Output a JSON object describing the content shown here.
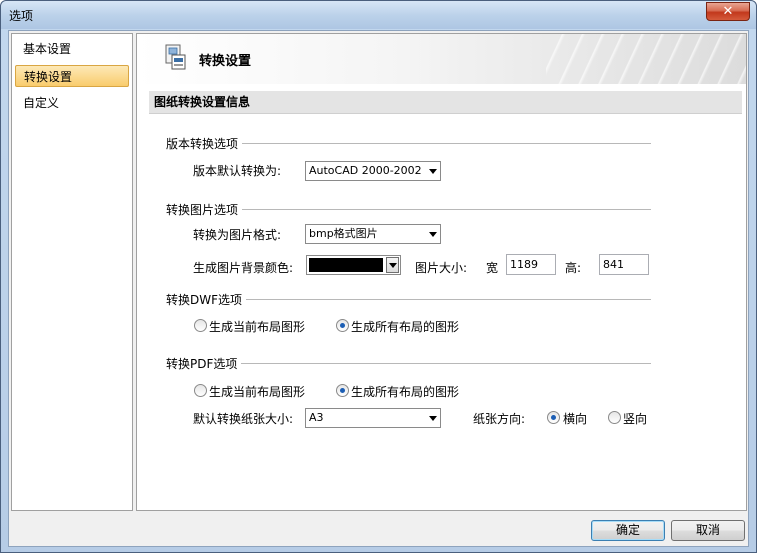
{
  "window": {
    "title": "选项",
    "close_glyph": "✕"
  },
  "sidebar": {
    "items": [
      {
        "label": "基本设置",
        "selected": false
      },
      {
        "label": "转换设置",
        "selected": true
      },
      {
        "label": "自定义",
        "selected": false
      }
    ]
  },
  "banner": {
    "title": "转换设置",
    "icon": "convert-settings-icon"
  },
  "section": {
    "title": "图纸转换设置信息"
  },
  "version_group": {
    "title": "版本转换选项",
    "default_label": "版本默认转换为:",
    "default_value": "AutoCAD 2000-2002"
  },
  "image_group": {
    "title": "转换图片选项",
    "format_label": "转换为图片格式:",
    "format_value": "bmp格式图片",
    "bg_label": "生成图片背景颜色:",
    "bg_color": "#000000",
    "size_label": "图片大小:",
    "width_label": "宽",
    "width_value": "1189",
    "height_label": "高:",
    "height_value": "841"
  },
  "dwf_group": {
    "title": "转换DWF选项",
    "option_current": "生成当前布局图形",
    "option_all": "生成所有布局的图形",
    "selected": "all"
  },
  "pdf_group": {
    "title": "转换PDF选项",
    "option_current": "生成当前布局图形",
    "option_all": "生成所有布局的图形",
    "selected": "all",
    "paper_size_label": "默认转换纸张大小:",
    "paper_size_value": "A3",
    "orientation_label": "纸张方向:",
    "landscape_label": "横向",
    "portrait_label": "竖向",
    "orientation": "landscape"
  },
  "footer": {
    "ok_label": "确定",
    "cancel_label": "取消"
  },
  "colors": {
    "selection": "#f9cc6d",
    "radio_dot": "#1c5eb4"
  }
}
